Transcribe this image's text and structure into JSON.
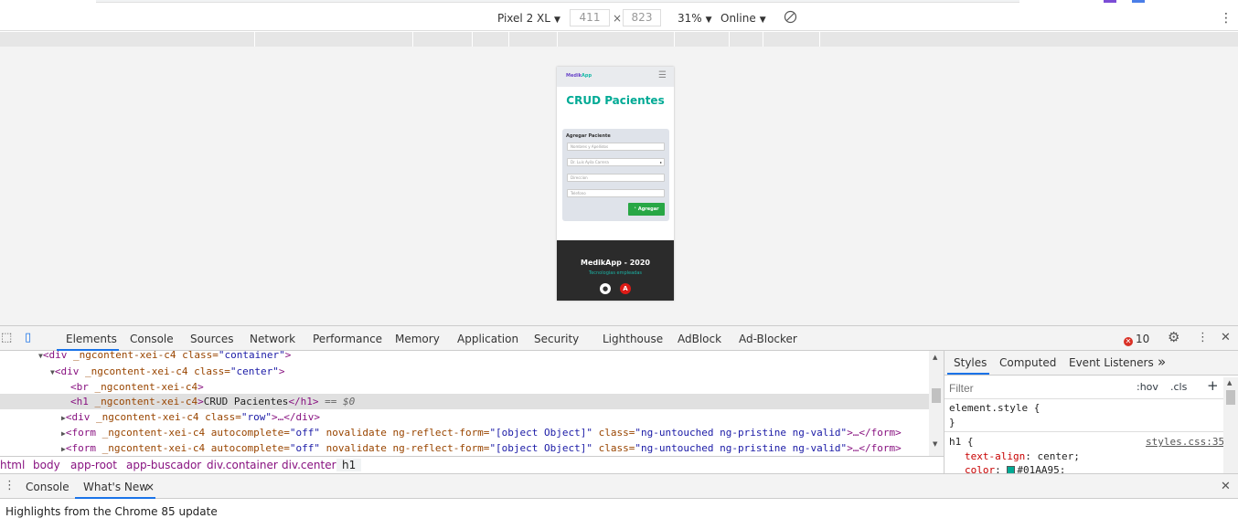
{
  "device_toolbar": {
    "device": "Pixel 2 XL",
    "width": "411",
    "times": "×",
    "height": "823",
    "zoom": "31%",
    "throttle": "Online"
  },
  "phone": {
    "brand_a": "Medik",
    "brand_b": "App",
    "title": "CRUD Pacientes",
    "card_title": "Agregar Paciente",
    "fields": {
      "name_placeholder": "Nombres y Apellidos",
      "doctor_value": "Dr. Luis Ayila Carrera",
      "address_placeholder": "Direccion",
      "phone_placeholder": "Telefono"
    },
    "add_button": "Agregar",
    "footer_title": "MedikApp - 2020",
    "footer_sub": "Tecnologias empleadas"
  },
  "devtools": {
    "tabs": [
      "Elements",
      "Console",
      "Sources",
      "Network",
      "Performance",
      "Memory",
      "Application",
      "Security",
      "Lighthouse",
      "AdBlock",
      "Ad-Blocker"
    ],
    "error_count": "10",
    "dom": {
      "l1_tag": "<div",
      "l1_attr": " _ngcontent-xei-c4",
      "l1_cls": " class=",
      "l1_val": "\"container\"",
      "l1_end": ">",
      "l2_tag": "<div",
      "l2_attr": " _ngcontent-xei-c4",
      "l2_cls": " class=",
      "l2_val": "\"center\"",
      "l2_end": ">",
      "l3_tag": "<br",
      "l3_attr": " _ngcontent-xei-c4",
      "l3_end": ">",
      "l4_tag": "<h1",
      "l4_attr": " _ngcontent-xei-c4",
      "l4_end": ">",
      "l4_text": "CRUD Pacientes",
      "l4_close": "</h1>",
      "l4_eq": " == $0",
      "l5_tag": "<div",
      "l5_attr": " _ngcontent-xei-c4",
      "l5_cls": " class=",
      "l5_val": "\"row\"",
      "l5_end": ">…</div>",
      "form_tag": "<form",
      "form_attr": " _ngcontent-xei-c4 autocomplete=",
      "form_ac": "\"off\"",
      "form_nv": " novalidate ng-reflect-form=",
      "form_rf": "\"[object Object]\"",
      "form_cls": " class=",
      "form_cv": "\"ng-untouched ng-pristine ng-valid\"",
      "form_end": ">…</form>"
    },
    "breadcrumb": [
      "html",
      "body",
      "app-root",
      "app-buscador",
      "div.container",
      "div.center",
      "h1"
    ],
    "styles_tabs": [
      "Styles",
      "Computed",
      "Event Listeners",
      "»"
    ],
    "filter_placeholder": "Filter",
    "hov": ":hov",
    "cls": ".cls",
    "plus": "+",
    "element_style": "element.style {",
    "close_brace": "}",
    "h1_selector": "h1 {",
    "styles_link": "styles.css:35",
    "prop1": "text-align",
    "val1": "center;",
    "prop2": "color",
    "val2": "#01AA95;",
    "colon": ": "
  },
  "drawer": {
    "tabs": [
      "Console",
      "What's New"
    ],
    "close_tab": "×",
    "body": "Highlights from the Chrome 85 update"
  },
  "colors": {
    "accent": "#01AA95",
    "tab_underline": "#1a73e8",
    "button_green": "#28a745"
  }
}
